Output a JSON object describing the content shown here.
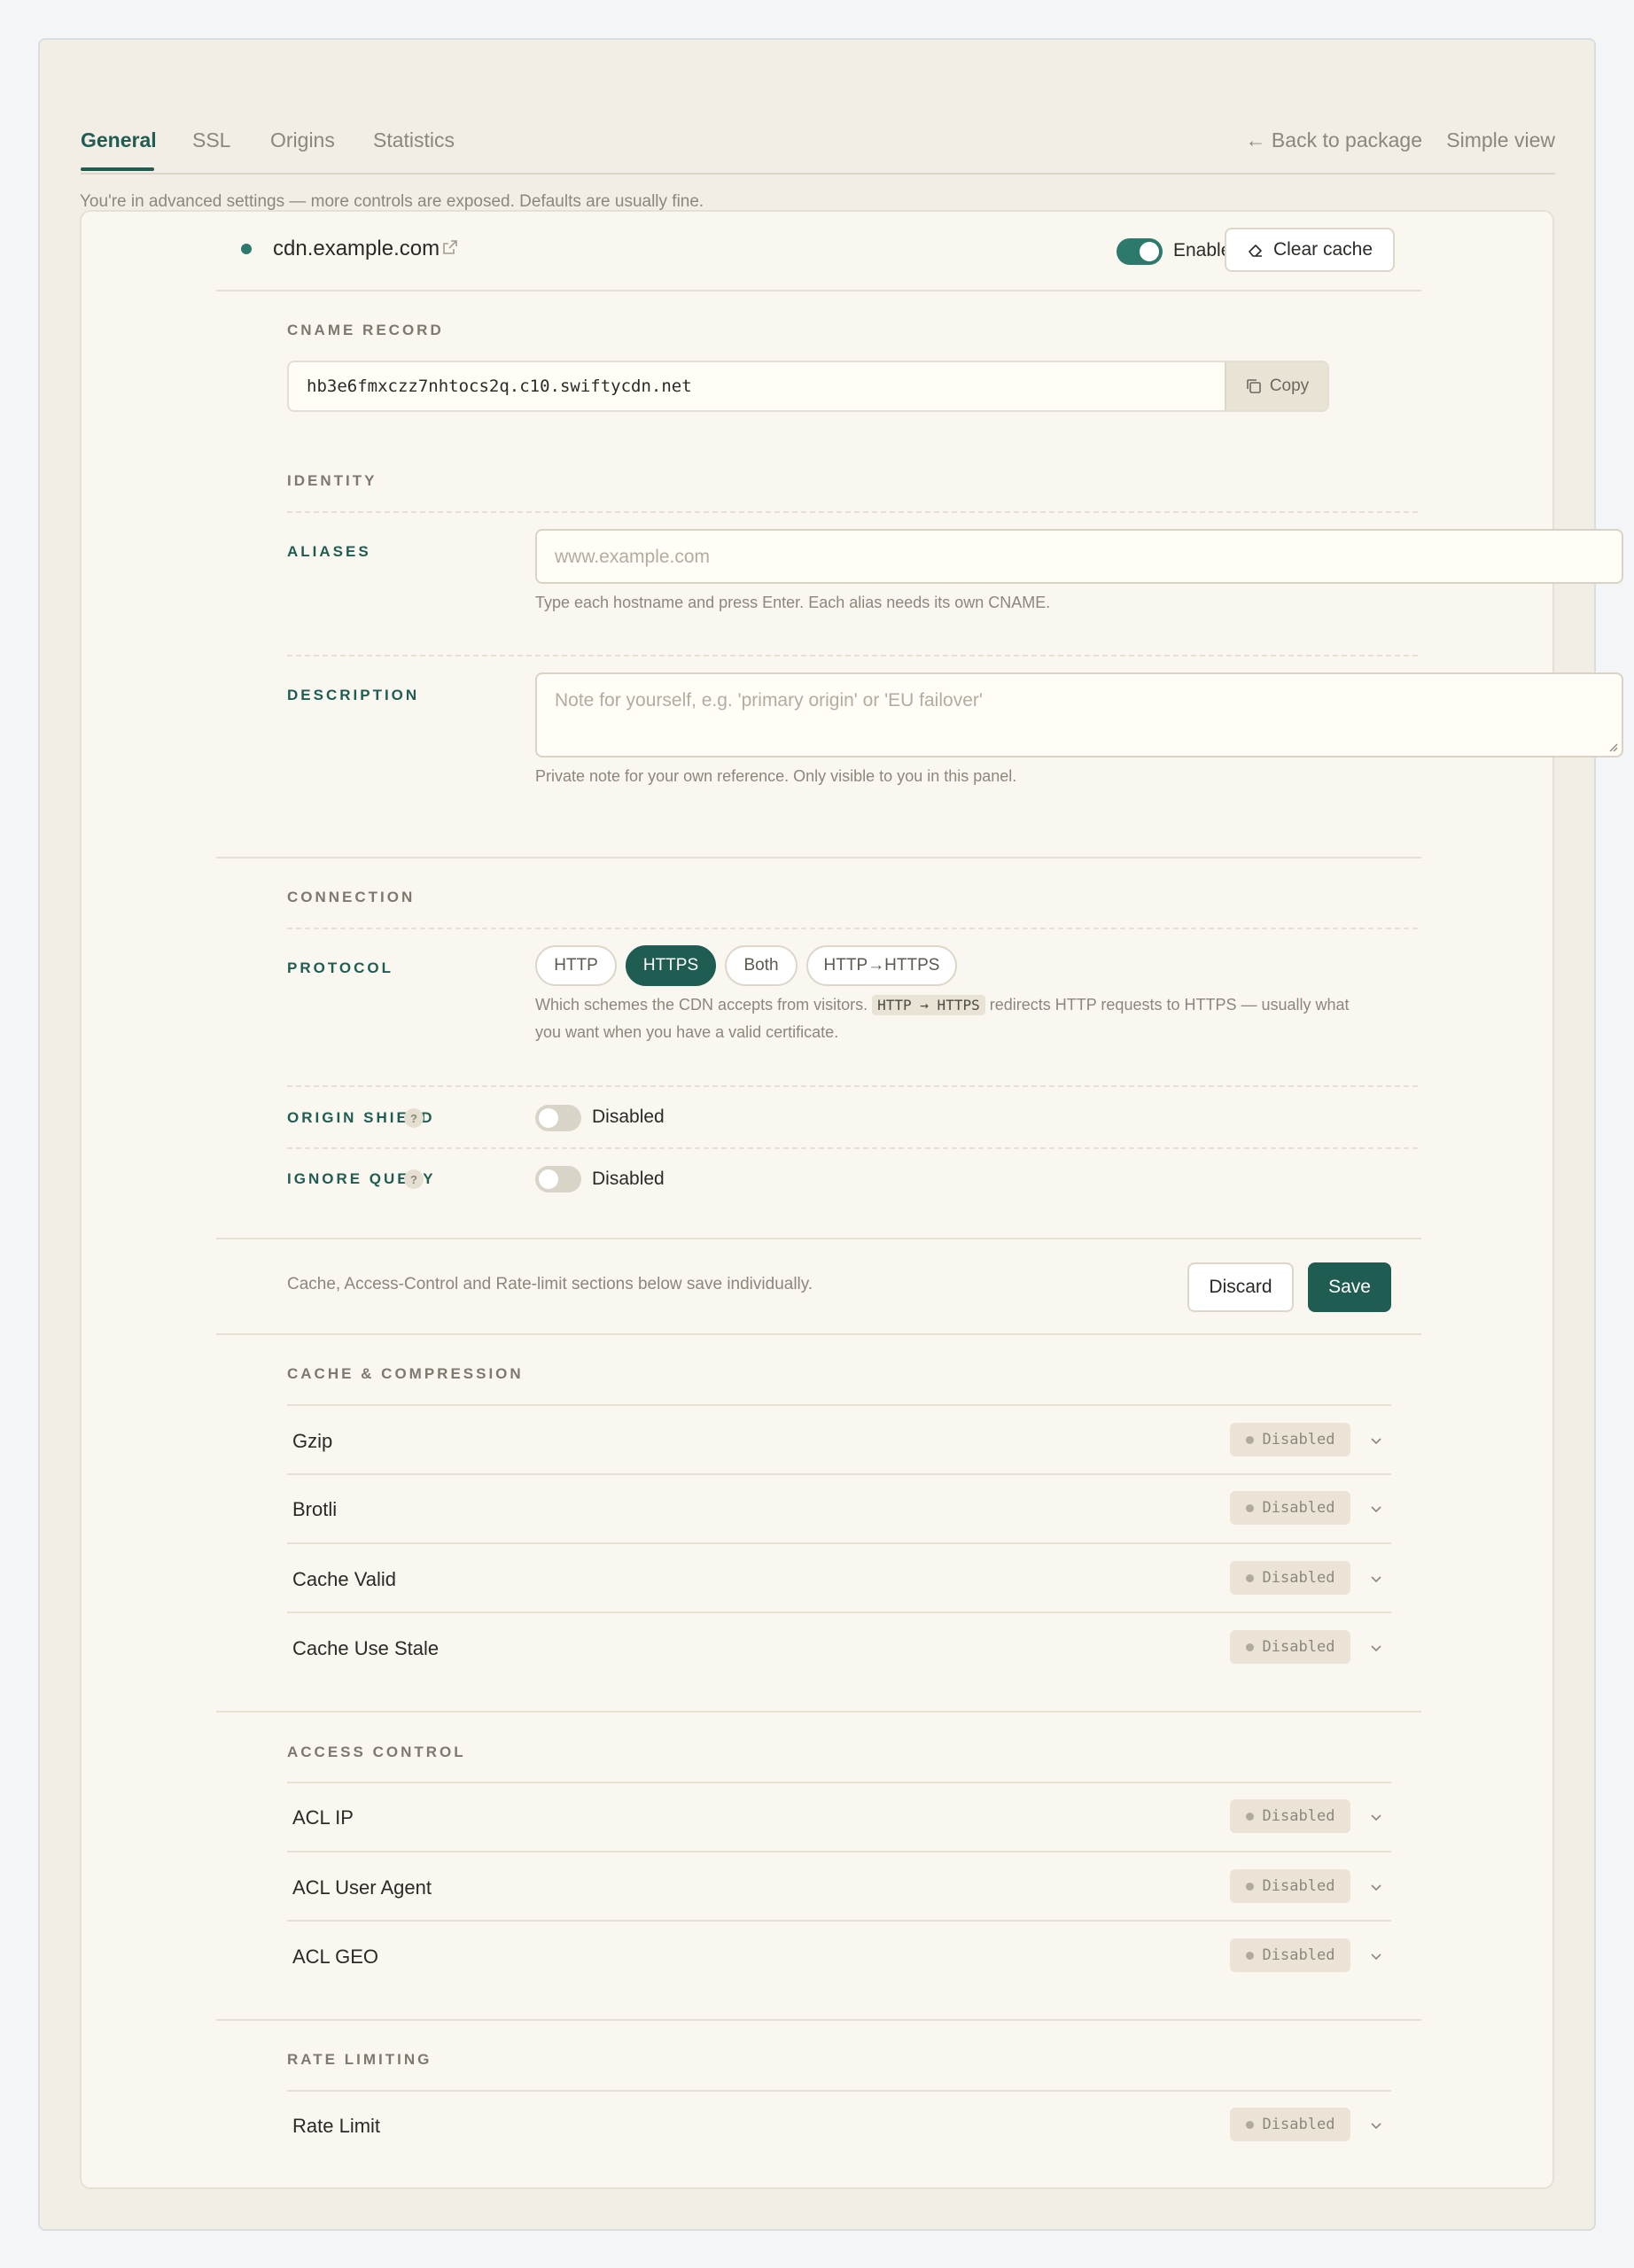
{
  "tabs": [
    {
      "label": "General",
      "active": true
    },
    {
      "label": "SSL",
      "active": false
    },
    {
      "label": "Origins",
      "active": false
    },
    {
      "label": "Statistics",
      "active": false
    }
  ],
  "header": {
    "back_link": "← Back to package",
    "simple_view": "Simple view",
    "advanced_note": "You're in advanced settings — more controls are exposed. Defaults are usually fine."
  },
  "resource": {
    "domain": "cdn.example.com",
    "status_color": "#2c7a6b",
    "enabled_label": "Enabled",
    "enabled": true,
    "clear_cache_label": "Clear cache"
  },
  "cname": {
    "section_label": "CNAME RECORD",
    "value": "hb3e6fmxczz7nhtocs2q.c10.swiftycdn.net",
    "copy_label": "Copy"
  },
  "identity": {
    "section_label": "IDENTITY",
    "aliases_label": "ALIASES",
    "aliases_placeholder": "www.example.com",
    "aliases_help": "Type each hostname and press Enter. Each alias needs its own CNAME.",
    "description_label": "DESCRIPTION",
    "description_placeholder": "Note for yourself, e.g. 'primary origin' or 'EU failover'",
    "description_help": "Private note for your own reference. Only visible to you in this panel."
  },
  "connection": {
    "section_label": "CONNECTION",
    "protocol_label": "PROTOCOL",
    "protocol_options": [
      "HTTP",
      "HTTPS",
      "Both",
      "HTTP→HTTPS"
    ],
    "protocol_selected": "HTTPS",
    "protocol_help_pre": "Which schemes the CDN accepts from visitors.",
    "protocol_help_code": "HTTP → HTTPS",
    "protocol_help_post": "redirects HTTP requests to HTTPS — usually what",
    "protocol_help_line2": "you want when you have a valid certificate.",
    "origin_shield_label": "ORIGIN SHIELD",
    "origin_shield_state": "Disabled",
    "ignore_query_label": "IGNORE QUERY",
    "ignore_query_state": "Disabled",
    "help_badge": "?"
  },
  "save_bar": {
    "note": "Cache, Access-Control and Rate-limit sections below save individually.",
    "discard_label": "Discard",
    "save_label": "Save"
  },
  "cache": {
    "section_label": "CACHE & COMPRESSION",
    "items": [
      {
        "name": "Gzip",
        "status": "Disabled"
      },
      {
        "name": "Brotli",
        "status": "Disabled"
      },
      {
        "name": "Cache Valid",
        "status": "Disabled"
      },
      {
        "name": "Cache Use Stale",
        "status": "Disabled"
      }
    ]
  },
  "access": {
    "section_label": "ACCESS CONTROL",
    "items": [
      {
        "name": "ACL IP",
        "status": "Disabled"
      },
      {
        "name": "ACL User Agent",
        "status": "Disabled"
      },
      {
        "name": "ACL GEO",
        "status": "Disabled"
      }
    ]
  },
  "rate": {
    "section_label": "RATE LIMITING",
    "items": [
      {
        "name": "Rate Limit",
        "status": "Disabled"
      }
    ]
  },
  "colors": {
    "accent": "#1f5c52",
    "toggle_on": "#2c7a6b"
  }
}
